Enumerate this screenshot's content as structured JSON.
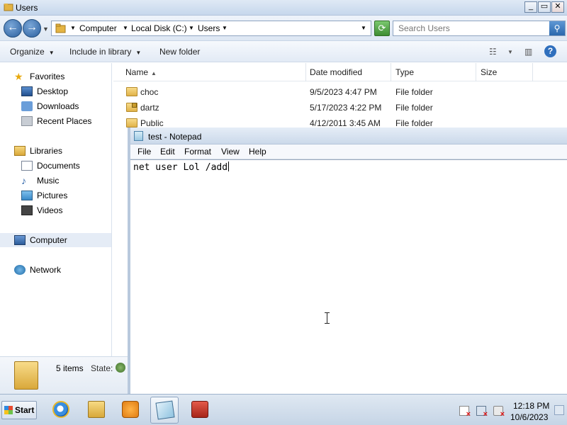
{
  "explorer": {
    "title": "Users",
    "breadcrumb": [
      "Computer",
      "Local Disk (C:)",
      "Users"
    ],
    "search_placeholder": "Search Users",
    "toolbar": {
      "organize": "Organize",
      "include_in_library": "Include in library",
      "new_folder": "New folder"
    },
    "nav": {
      "favorites": "Favorites",
      "desktop": "Desktop",
      "downloads": "Downloads",
      "recent_places": "Recent Places",
      "libraries": "Libraries",
      "documents": "Documents",
      "music": "Music",
      "pictures": "Pictures",
      "videos": "Videos",
      "computer": "Computer",
      "network": "Network"
    },
    "columns": [
      "Name",
      "Date modified",
      "Type",
      "Size"
    ],
    "files": [
      {
        "name": "choc",
        "date": "9/5/2023 4:47 PM",
        "type": "File folder",
        "size": ""
      },
      {
        "name": "dartz",
        "date": "5/17/2023 4:22 PM",
        "type": "File folder",
        "size": ""
      },
      {
        "name": "Public",
        "date": "4/12/2011 3:45 AM",
        "type": "File folder",
        "size": ""
      }
    ],
    "details": {
      "count": "5 items",
      "state_label": "State:"
    }
  },
  "notepad": {
    "title": "test - Notepad",
    "menu": [
      "File",
      "Edit",
      "Format",
      "View",
      "Help"
    ],
    "content": "net user Lol /add"
  },
  "taskbar": {
    "start": "Start",
    "time": "12:18 PM",
    "date": "10/6/2023"
  }
}
